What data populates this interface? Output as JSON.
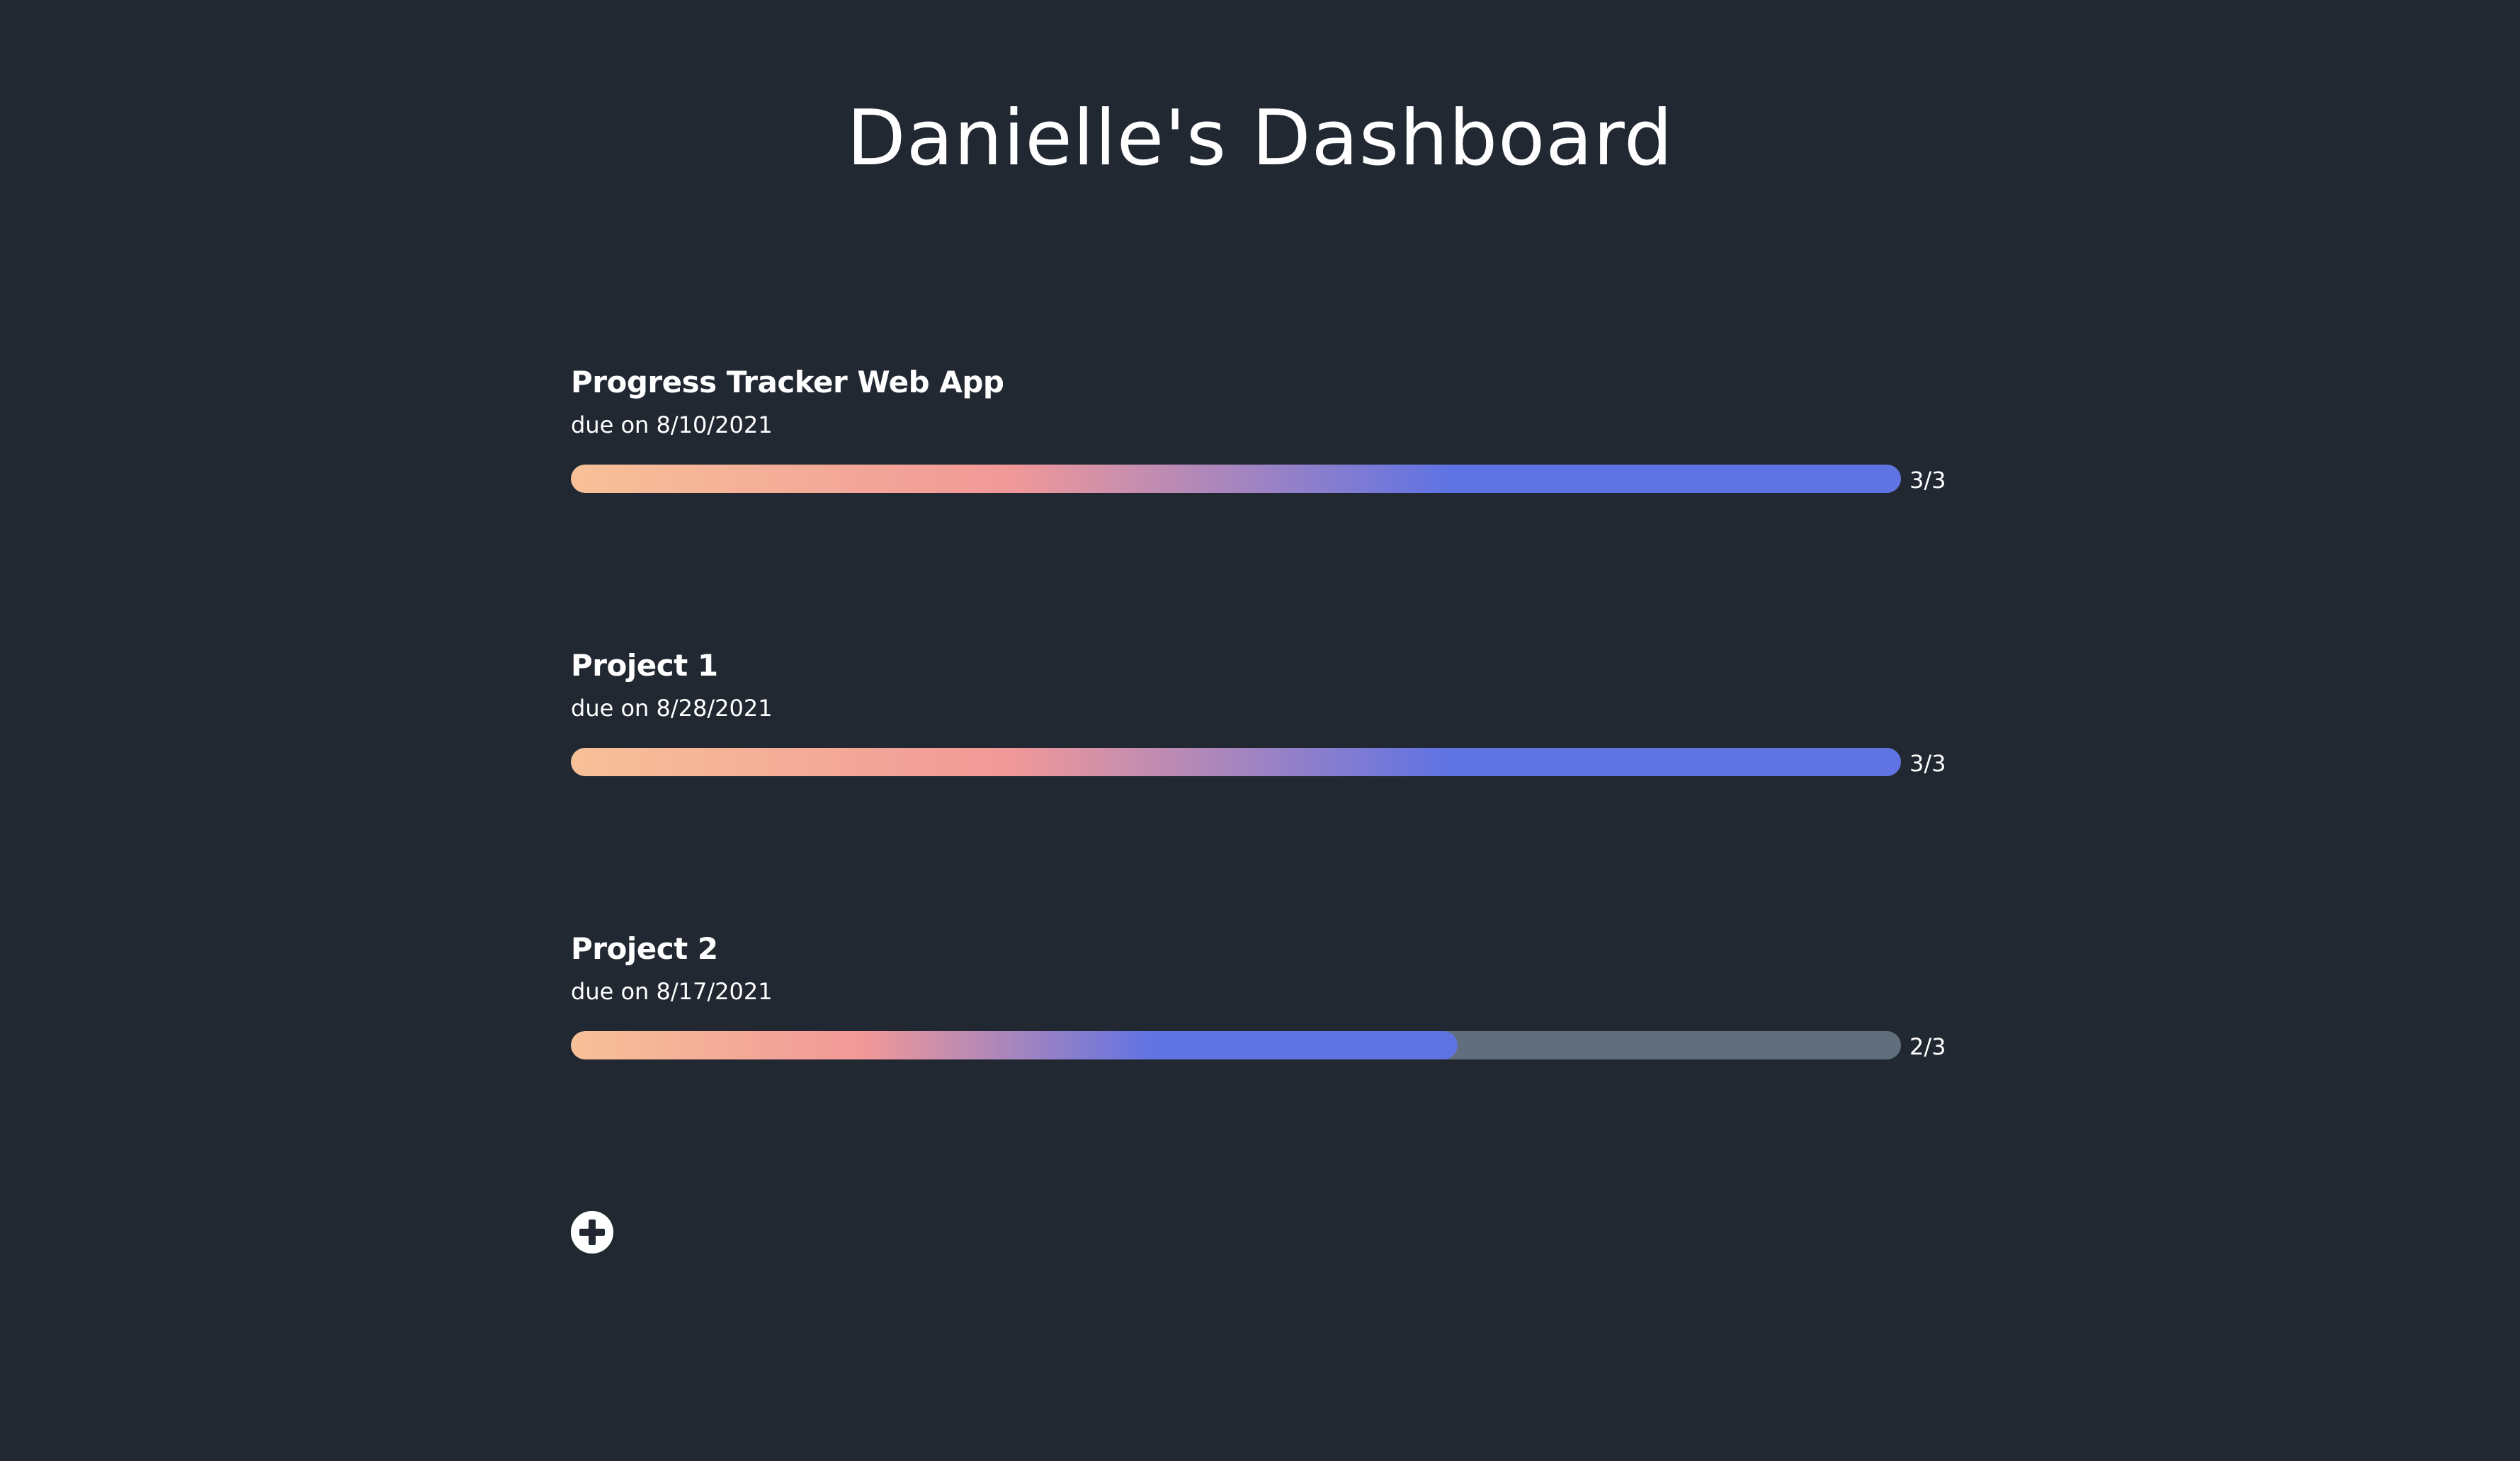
{
  "header": {
    "title": "Danielle's Dashboard"
  },
  "colors": {
    "background": "#212832",
    "track": "#616e7b",
    "gradient_start": "#f7c198",
    "gradient_mid": "#f19898",
    "gradient_end": "#5f73e3",
    "text": "#ffffff"
  },
  "projects": [
    {
      "name": "Progress Tracker Web App",
      "due": "due on 8/10/2021",
      "progress_label": "3/3",
      "completed": 3,
      "total": 3
    },
    {
      "name": "Project 1",
      "due": "due on 8/28/2021",
      "progress_label": "3/3",
      "completed": 3,
      "total": 3
    },
    {
      "name": "Project 2",
      "due": "due on 8/17/2021",
      "progress_label": "2/3",
      "completed": 2,
      "total": 3
    }
  ],
  "add_button": {
    "icon": "plus-circle-icon"
  }
}
